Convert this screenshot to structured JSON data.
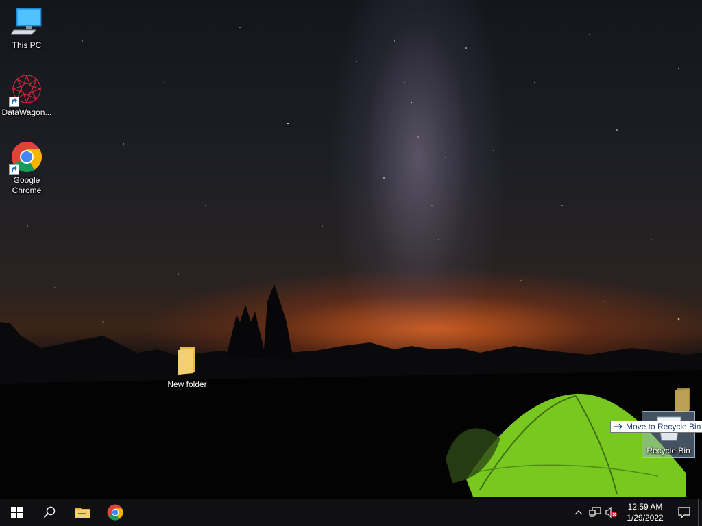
{
  "desktop": {
    "icons": [
      {
        "label": "This PC",
        "icon": "this-pc-icon"
      },
      {
        "label": "DataWagon...",
        "icon": "datawagon-icon"
      },
      {
        "label": "Google Chrome",
        "icon": "chrome-icon"
      },
      {
        "label": "New folder",
        "icon": "folder-icon"
      }
    ],
    "recycle_bin": {
      "label": "Recycle Bin",
      "icon": "recycle-bin-icon"
    },
    "drag_tooltip": {
      "text": "Move to Recycle Bin",
      "icon": "arrow-right-icon"
    }
  },
  "taskbar": {
    "start": {
      "icon": "windows-logo-icon"
    },
    "search": {
      "icon": "search-icon"
    },
    "pinned": [
      {
        "name": "File Explorer",
        "icon": "file-explorer-icon"
      },
      {
        "name": "Google Chrome",
        "icon": "chrome-icon"
      }
    ],
    "tray": {
      "chevron_icon": "chevron-up-icon",
      "network_icon": "network-icon",
      "volume_icon": "volume-muted-icon",
      "time": "12:59 AM",
      "date": "1/29/2022",
      "notification_icon": "notification-icon"
    }
  },
  "colors": {
    "taskbar": "#101012",
    "tooltip_text": "#1e3c72",
    "tent_green": "#7ed321",
    "folder_yellow": "#f4d06f"
  }
}
